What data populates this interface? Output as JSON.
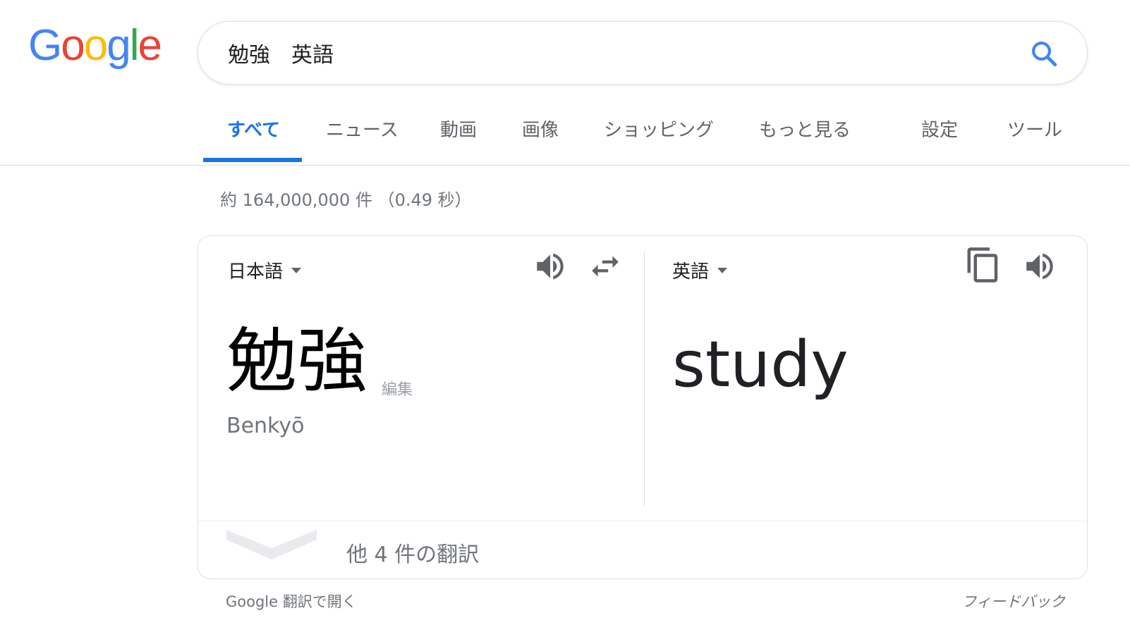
{
  "logo": {
    "letters": [
      "G",
      "o",
      "o",
      "g",
      "l",
      "e"
    ],
    "colors": [
      "#4285F4",
      "#EA4335",
      "#FBBC05",
      "#4285F4",
      "#34A853",
      "#EA4335"
    ]
  },
  "search": {
    "value": "勉強　英語",
    "icon": "search-icon",
    "icon_color": "#4285F4"
  },
  "tabs": [
    {
      "label": "すべて",
      "active": true
    },
    {
      "label": "ニュース",
      "active": false
    },
    {
      "label": "動画",
      "active": false
    },
    {
      "label": "画像",
      "active": false
    },
    {
      "label": "ショッピング",
      "active": false
    },
    {
      "label": "もっと見る",
      "active": false
    },
    {
      "label": "設定",
      "active": false
    },
    {
      "label": "ツール",
      "active": false
    }
  ],
  "accent_color": "#1a73e8",
  "result_stats": "約 164,000,000 件 （0.49 秒）",
  "translate": {
    "source_lang": "日本語",
    "target_lang": "英語",
    "source_text": "勉強",
    "edit_label": "編集",
    "romanization": "Benkyō",
    "target_text": "study",
    "more_translations": "他 4 件の翻訳",
    "icons": {
      "source_speaker": "speaker-icon",
      "swap": "swap-icon",
      "copy": "copy-icon",
      "target_speaker": "speaker-icon",
      "expand": "chevron-down-icon"
    }
  },
  "footer": {
    "open_in_translate": "Google 翻訳で開く",
    "feedback": "フィードバック"
  }
}
